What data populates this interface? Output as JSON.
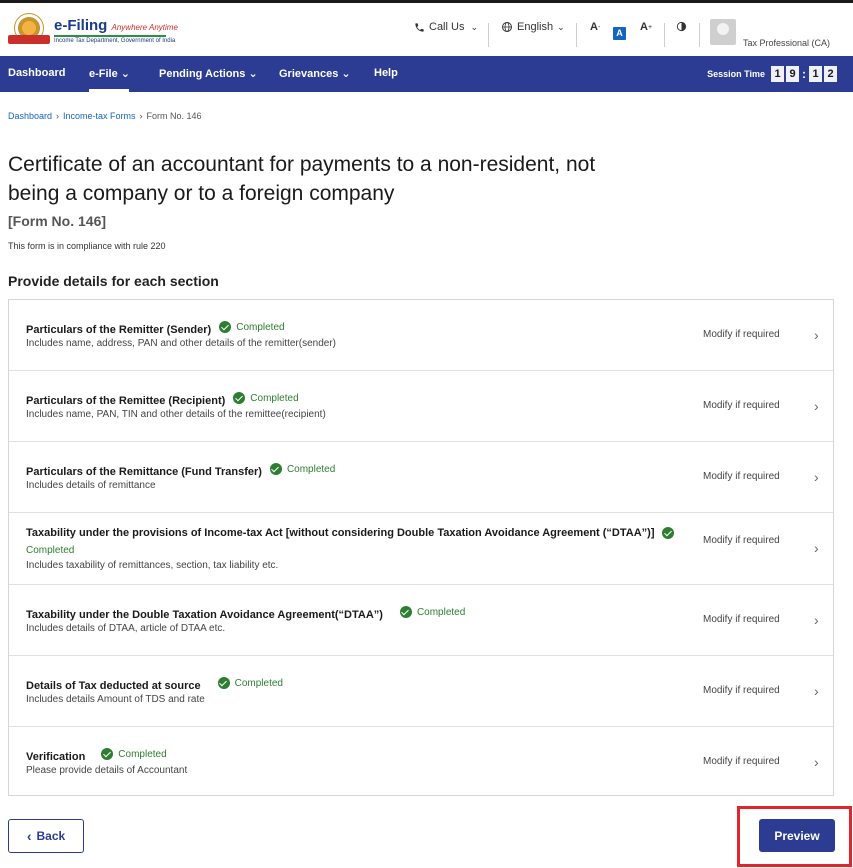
{
  "header": {
    "logo_title": "e-Filing",
    "logo_tagline": "Anywhere Anytime",
    "logo_subtitle": "Income Tax Department, Government of India",
    "call_us": "Call Us",
    "language": "English",
    "font_decrease": "A",
    "font_reset": "A",
    "font_increase": "A",
    "profile_role": "Tax Professional (CA)"
  },
  "nav": {
    "items": [
      {
        "label": "Dashboard",
        "has_dropdown": false
      },
      {
        "label": "e-File",
        "has_dropdown": true
      },
      {
        "label": "Pending Actions",
        "has_dropdown": true
      },
      {
        "label": "Grievances",
        "has_dropdown": true
      },
      {
        "label": "Help",
        "has_dropdown": false
      }
    ],
    "session_label": "Session Time",
    "session_digits": [
      "1",
      "9",
      "1",
      "2"
    ]
  },
  "breadcrumb": {
    "items": [
      "Dashboard",
      "Income-tax Forms"
    ],
    "current": "Form No. 146"
  },
  "page": {
    "title": "Certificate of an accountant for payments to a non-resident, not being a company or to a foreign company",
    "form_number": "[Form No. 146]",
    "compliance": "This form is in compliance with rule 220",
    "section_heading": "Provide details for each section"
  },
  "sections": [
    {
      "title": "Particulars of the Remitter (Sender)",
      "status": "Completed",
      "description": "Includes name, address, PAN and other details of the remitter(sender)",
      "action": "Modify if required"
    },
    {
      "title": "Particulars of the Remittee (Recipient)",
      "status": "Completed",
      "description": "Includes name, PAN, TIN and other details of the remittee(recipient)",
      "action": "Modify if required"
    },
    {
      "title": "Particulars of the Remittance (Fund Transfer)",
      "status": "Completed",
      "description": "Includes details of remittance",
      "action": "Modify if required"
    },
    {
      "title": "Taxability under the provisions of Income-tax Act [without considering Double Taxation Avoidance Agreement (“DTAA”)]",
      "status": "Completed",
      "description": "Includes taxability of remittances, section, tax liability etc.",
      "action": "Modify if required"
    },
    {
      "title": "Taxability under the Double Taxation Avoidance Agreement(“DTAA”)",
      "status": "Completed",
      "description": "Includes details of DTAA, article of DTAA etc.",
      "action": "Modify if required"
    },
    {
      "title": "Details of Tax deducted at source",
      "status": "Completed",
      "description": "Includes details Amount of TDS and rate",
      "action": "Modify if required"
    },
    {
      "title": "Verification",
      "status": "Completed",
      "description": "Please provide details of Accountant",
      "action": "Modify if required"
    }
  ],
  "footer": {
    "back_label": "Back",
    "preview_label": "Preview"
  },
  "colors": {
    "primary": "#2b3c92",
    "success": "#2e7d32",
    "highlight": "#e0262b"
  }
}
